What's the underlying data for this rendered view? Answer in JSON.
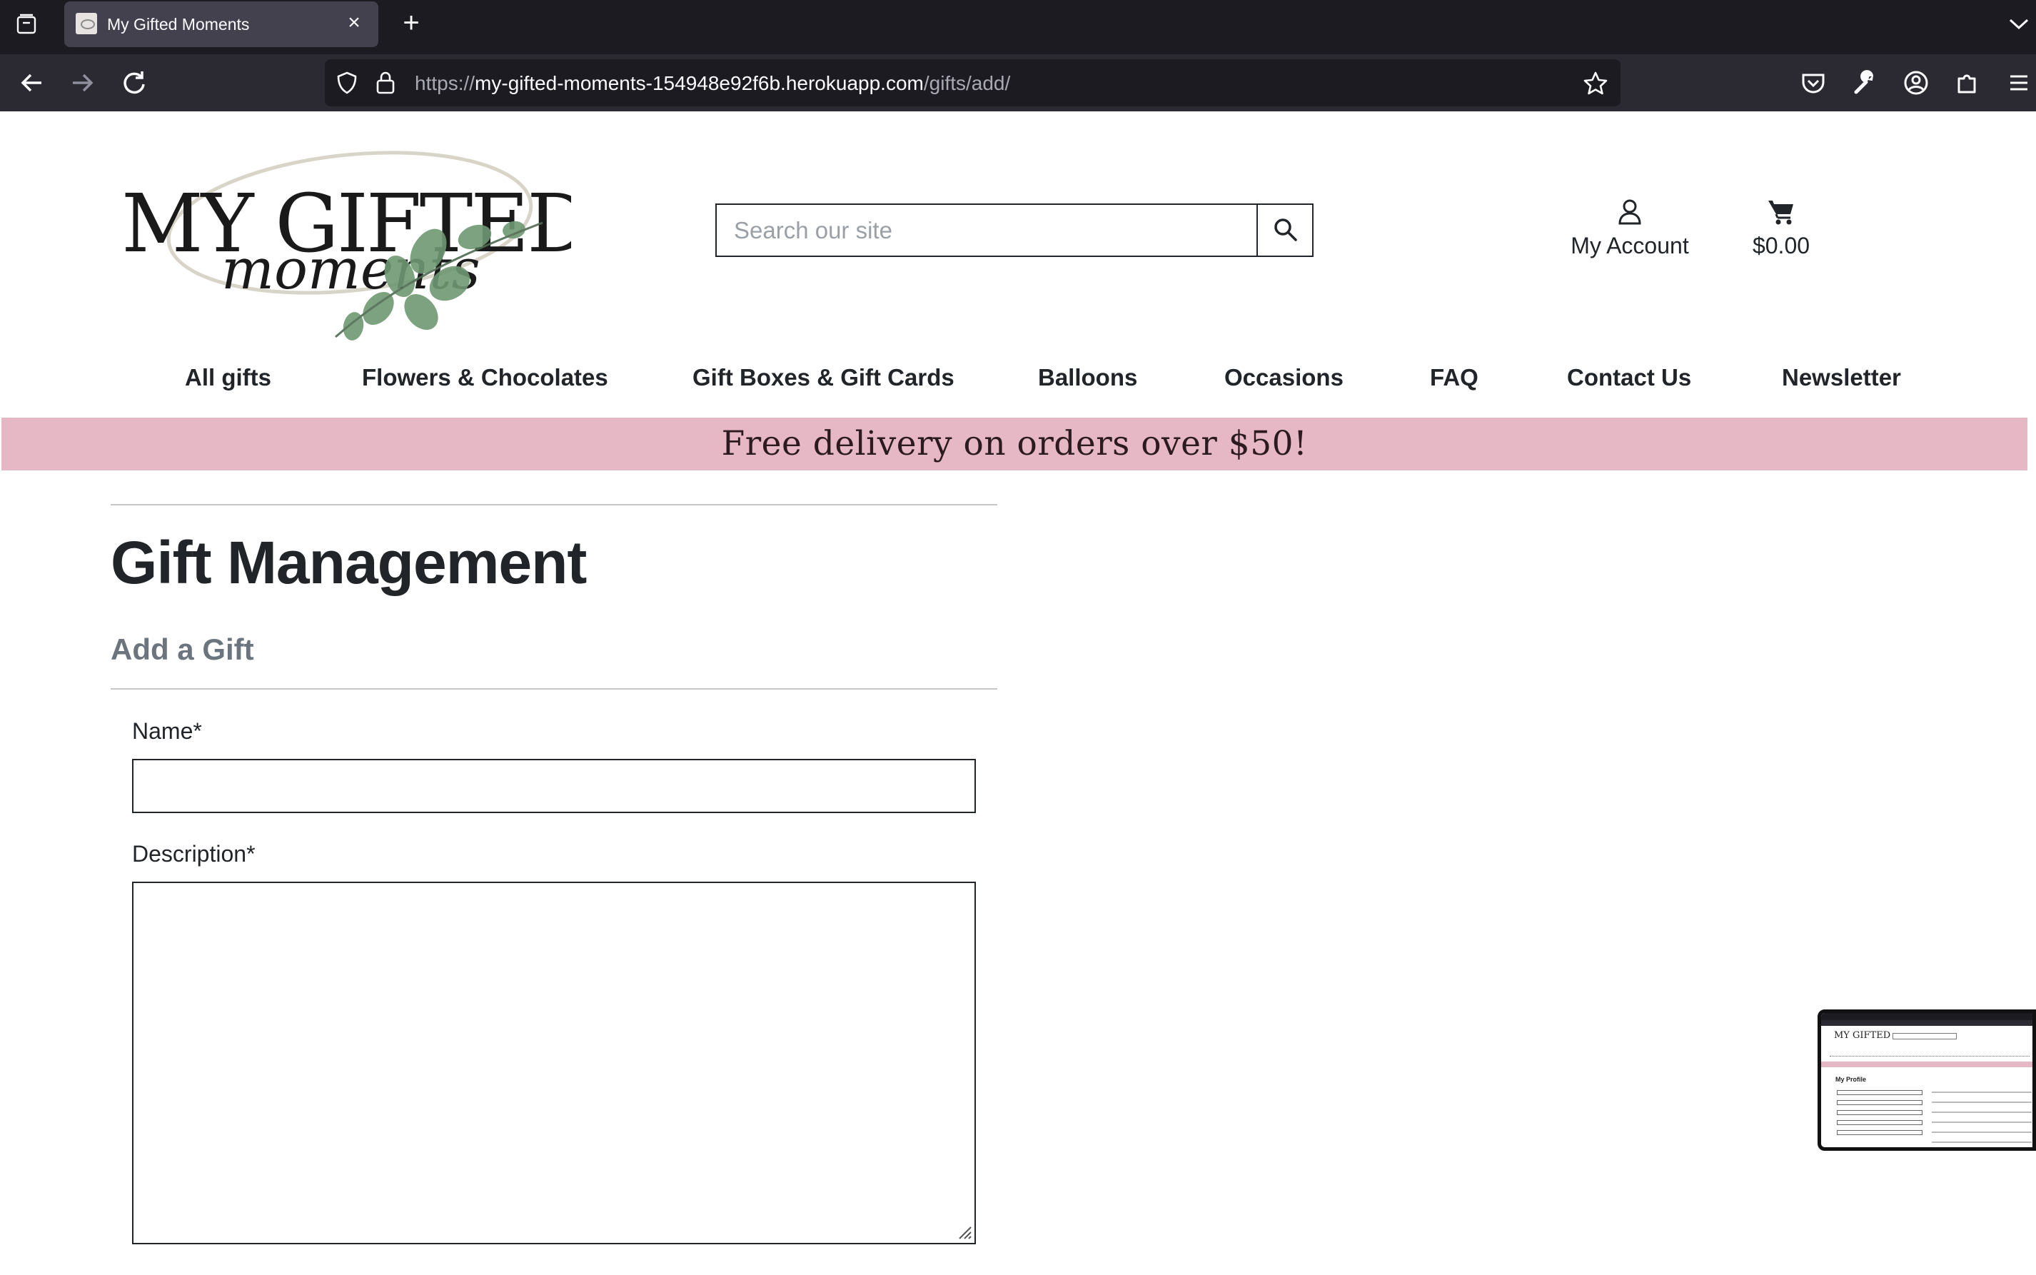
{
  "browser": {
    "tab": {
      "title": "My Gifted Moments"
    },
    "url": {
      "scheme": "https://",
      "host": "my-gifted-moments-154948e92f6b.herokuapp.com",
      "path": "/gifts/add/"
    }
  },
  "header": {
    "logo": {
      "line1": "MY GIFTED",
      "line2": "moments"
    },
    "search": {
      "placeholder": "Search our site"
    },
    "account_label": "My Account",
    "bag_total": "$0.00"
  },
  "nav": {
    "items": [
      {
        "label": "All gifts"
      },
      {
        "label": "Flowers & Chocolates"
      },
      {
        "label": "Gift Boxes & Gift Cards"
      },
      {
        "label": "Balloons"
      },
      {
        "label": "Occasions"
      },
      {
        "label": "FAQ"
      },
      {
        "label": "Contact Us"
      },
      {
        "label": "Newsletter"
      }
    ]
  },
  "banner": {
    "text": "Free delivery on orders over $50!"
  },
  "page": {
    "title": "Gift Management",
    "subtitle": "Add a Gift",
    "form": {
      "name_label": "Name*",
      "name_value": "",
      "description_label": "Description*",
      "description_value": ""
    }
  },
  "pip": {
    "title": "My Profile"
  },
  "colors": {
    "banner": "#e6b8c6",
    "chrome_dark": "#1c1b22",
    "chrome_nav": "#2b2a33",
    "text": "#212529",
    "muted": "#6c757d"
  }
}
